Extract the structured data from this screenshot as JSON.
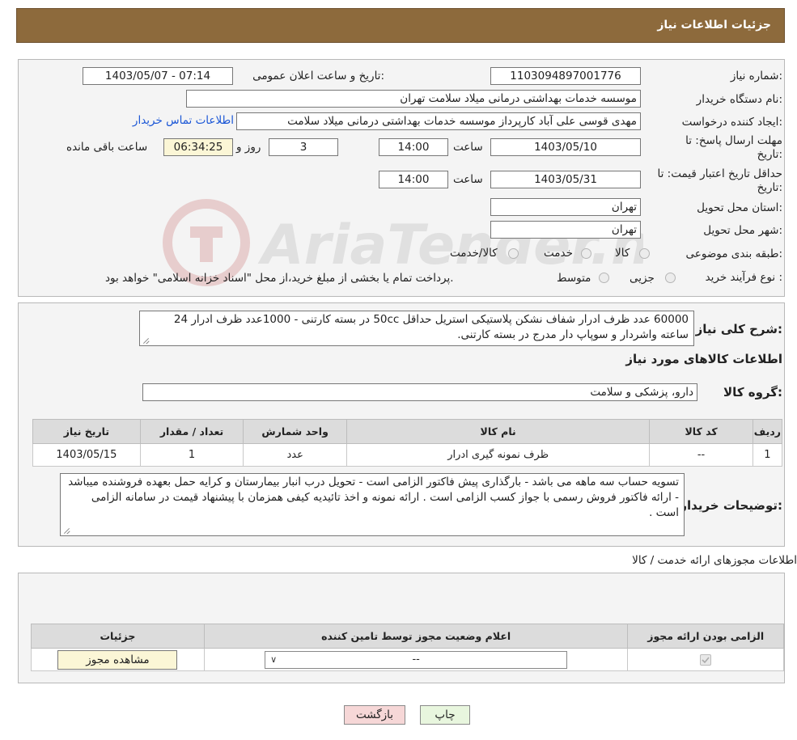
{
  "header": {
    "title": "جزئیات اطلاعات نیاز"
  },
  "watermark": {
    "text": "AriaTender.neT"
  },
  "form": {
    "need_number_label": "شماره نیاز:",
    "need_number": "1103094897001776",
    "announce_label": "تاریخ و ساعت اعلان عمومی:",
    "announce_value": "1403/05/07 - 07:14",
    "buyer_org_label": "نام دستگاه خریدار:",
    "buyer_org": "موسسه خدمات بهداشتی درمانی میلاد سلامت تهران",
    "creator_label": "ایجاد کننده درخواست:",
    "creator": "مهدی قوسی علی آباد کارپرداز موسسه خدمات بهداشتی درمانی میلاد سلامت",
    "contact_link": "اطلاعات تماس خریدار",
    "deadline_label_1": "مهلت ارسال پاسخ: تا",
    "deadline_label_2": "تاریخ:",
    "deadline_date": "1403/05/10",
    "time_label": "ساعت",
    "deadline_time": "14:00",
    "days_value": "3",
    "days_label": "روز و",
    "remaining_time": "06:34:25",
    "remaining_label": "ساعت باقی مانده",
    "validity_label_1": "حداقل تاریخ اعتبار قیمت: تا",
    "validity_label_2": "تاریخ:",
    "validity_date": "1403/05/31",
    "validity_time": "14:00",
    "province_label": "استان محل تحویل:",
    "province": "تهران",
    "city_label": "شهر محل تحویل:",
    "city": "تهران",
    "category_label": "طبقه بندی موضوعی:",
    "category_options": [
      "کالا",
      "خدمت",
      "کالا/خدمت"
    ],
    "process_label": "نوع فرآیند خرید :",
    "process_options": [
      "جزیی",
      "متوسط"
    ],
    "process_note": "پرداخت تمام یا بخشی از مبلغ خرید،از محل \"اسناد خزانه اسلامی\" خواهد بود."
  },
  "details": {
    "summary_label": "شرح کلی نیاز:",
    "summary_text": "60000 عدد ظرف ادرار شفاف نشکن پلاستیکی استریل حداقل 50cc در بسته کارتنی - 1000عدد ظرف ادرار 24 ساعته واشردار و سوپاپ دار مدرج در بسته کارتنی.",
    "goods_info_title": "اطلاعات کالاهای مورد نیاز",
    "goods_group_label": "گروه کالا:",
    "goods_group": "دارو، پزشکی و سلامت",
    "table_headers": [
      "ردیف",
      "کد کالا",
      "نام کالا",
      "واحد شمارش",
      "تعداد / مقدار",
      "تاریخ نیاز"
    ],
    "rows": [
      [
        "1",
        "--",
        "ظرف نمونه گیری ادرار",
        "عدد",
        "1",
        "1403/05/15"
      ]
    ],
    "buyer_notes_label": "توضیحات خریدار:",
    "buyer_notes": "تسویه حساب سه ماهه می باشد - بارگذاری پیش فاکتور الزامی است - تحویل درب انبار بیمارستان و کرایه حمل بعهده فروشنده میباشد - ارائه فاکتور فروش رسمی با جواز کسب الزامی است . ارائه نمونه و اخذ تائیدیه کیفی همزمان با پیشنهاد قیمت در سامانه الزامی است ."
  },
  "permits": {
    "title": "اطلاعات مجوزهای ارائه خدمت / کالا",
    "headers": [
      "الزامی بودن ارائه مجوز",
      "اعلام وضعیت مجوز توسط تامین کننده",
      "جزئیات"
    ],
    "select_value": "--",
    "view_button": "مشاهده مجوز"
  },
  "buttons": {
    "print": "چاپ",
    "back": "بازگشت"
  },
  "colors": {
    "header_bg": "#8d6a3c",
    "link": "#1a56d6",
    "back_btn": "#f6d7d7",
    "print_btn": "#e8f6de"
  }
}
